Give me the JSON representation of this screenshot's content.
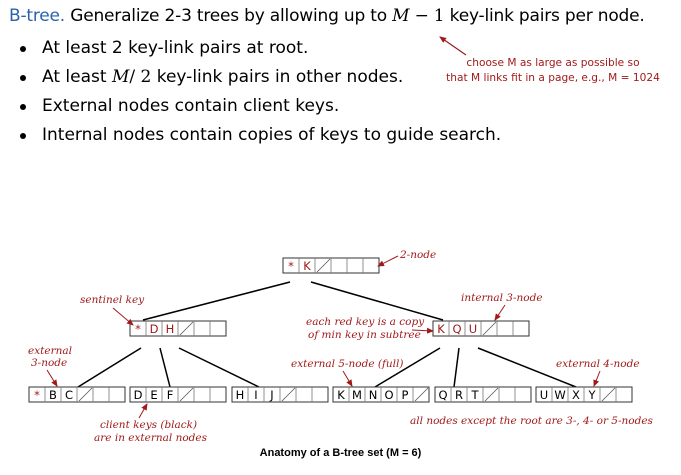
{
  "headline": {
    "term": "B-tree.",
    "text_before": "Generalize 2-3 trees by allowing up to",
    "m": "M",
    "minus": "− 1",
    "text_after": "key-link pairs per node."
  },
  "bullets": [
    {
      "pre": "At least 2 key-link pairs at root.",
      "math": "",
      "post": ""
    },
    {
      "pre": "At least",
      "math": "M",
      "mid": "/ 2",
      "post": "key-link pairs in other nodes."
    },
    {
      "pre": "External nodes contain client keys.",
      "math": "",
      "post": ""
    },
    {
      "pre": "Internal nodes contain copies of keys to guide search.",
      "math": "",
      "post": ""
    }
  ],
  "callout": {
    "line1": "choose M as large as possible so",
    "line2": "that M links fit in a page, e.g., M = 1024"
  },
  "colors": {
    "accent_blue": "#2b63a8",
    "annotation_red": "#a11a1a",
    "sentinel_red": "#a11a1a"
  },
  "tree": {
    "root": [
      "*",
      "K"
    ],
    "internal": [
      [
        "*",
        "D",
        "H"
      ],
      [
        "K",
        "Q",
        "U"
      ]
    ],
    "external": [
      [
        "*",
        "B",
        "C"
      ],
      [
        "D",
        "E",
        "F"
      ],
      [
        "H",
        "I",
        "J"
      ],
      [
        "K",
        "M",
        "N",
        "O",
        "P"
      ],
      [
        "Q",
        "R",
        "T"
      ],
      [
        "U",
        "W",
        "X",
        "Y"
      ]
    ]
  },
  "annotations": {
    "two_node": "2-node",
    "sentinel_key": "sentinel key",
    "internal_3_node": "internal 3-node",
    "red_key_1": "each red key is a copy",
    "red_key_2": "of min key in subtree",
    "external_3_node_1": "external",
    "external_3_node_2": "3-node",
    "external_5_node": "external 5-node (full)",
    "external_4_node": "external 4-node",
    "client_keys_1": "client keys (black)",
    "client_keys_2": "are in external nodes",
    "all_nodes": "all nodes except the root are 3-, 4- or 5-nodes"
  },
  "caption": "Anatomy of a B-tree set (M = 6)"
}
